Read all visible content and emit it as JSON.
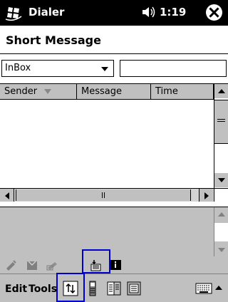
{
  "titlebar": {
    "app_name": "Dialer",
    "time": "1:19",
    "start_icon": "windows-flag-icon",
    "volume_icon": "speaker-icon",
    "close_icon": "close-icon"
  },
  "page": {
    "title": "Short Message"
  },
  "filter": {
    "folder_value": "InBox",
    "search_value": ""
  },
  "list": {
    "columns": [
      "Sender",
      "Message",
      "Time"
    ],
    "sort_indicator": "sort-down-icon",
    "rows": []
  },
  "toolbar": {
    "icons": [
      "reply-icon",
      "delete-icon",
      "compose-icon",
      "send-receive-icon",
      "properties-icon"
    ]
  },
  "menubar": {
    "items": [
      "Edit",
      "Tools"
    ],
    "icons": [
      "sync-icon",
      "phone-icon",
      "contacts-icon",
      "calendar-icon",
      "keyboard-icon",
      "input-arrow-icon"
    ]
  },
  "colors": {
    "titlebar": "#000000",
    "chrome": "#c0c0c0",
    "highlight": "#0000cc"
  }
}
